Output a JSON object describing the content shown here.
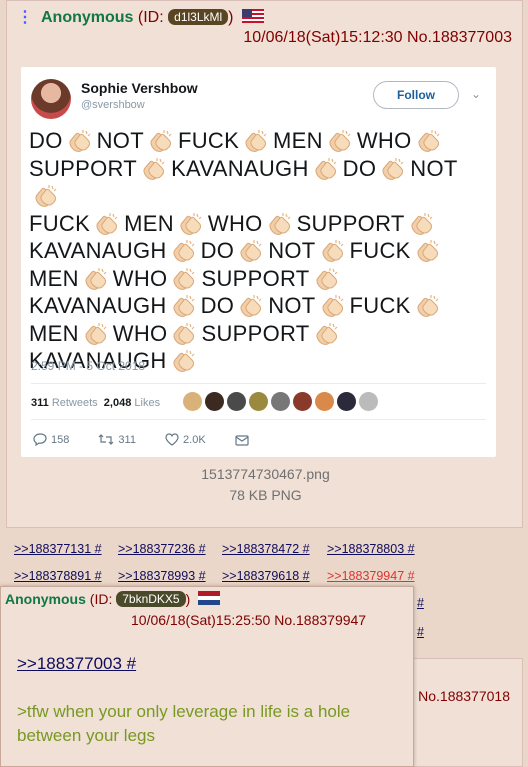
{
  "post1": {
    "menu": "⋮",
    "name": "Anonymous",
    "id_open": "(ID:",
    "id": "d1l3LkMl",
    "id_close": ")",
    "datetime": "10/06/18(Sat)15:12:30",
    "number": "No.188377003",
    "tweet": {
      "display_name": "Sophie Vershbow",
      "handle": "@svershbow",
      "follow": "Follow",
      "text_lines": [
        [
          "DO",
          "NOT",
          "FUCK",
          "MEN",
          "WHO"
        ],
        [
          "SUPPORT",
          "KAVANAUGH",
          "DO",
          "NOT"
        ],
        [
          "FUCK",
          "MEN",
          "WHO",
          "SUPPORT"
        ],
        [
          "KAVANAUGH",
          "DO",
          "NOT",
          "FUCK"
        ],
        [
          "MEN",
          "WHO",
          "SUPPORT"
        ],
        [
          "KAVANAUGH",
          "DO",
          "NOT",
          "FUCK"
        ],
        [
          "MEN",
          "WHO",
          "SUPPORT"
        ],
        [
          "KAVANAUGH"
        ]
      ],
      "date": "2:59 PM - 5 Oct 2018",
      "retweets": "311",
      "retweets_label": "Retweets",
      "likes": "2,048",
      "likes_label": "Likes",
      "replies_action": "158",
      "retweets_action": "311",
      "likes_action": "2.0K"
    },
    "file_name": "1513774730467.png",
    "file_info": "78 KB PNG"
  },
  "replies": [
    ">>188377131 #",
    ">>188377236 #",
    ">>188378472 #",
    ">>188378803 #",
    ">>188378891 #",
    ">>188378993 #",
    ">>188379618 #",
    ">>188379947 #",
    "#",
    "#"
  ],
  "post3": {
    "number": "No.188377018"
  },
  "hover_post": {
    "name": "Anonymous",
    "id_open": "(ID:",
    "id": "7bknDKX5",
    "id_close": ")",
    "datetime": "10/06/18(Sat)15:25:50",
    "number": "No.188379947",
    "quote": ">>188377003 #",
    "greentext": ">tfw when your only leverage in life is a hole between your legs"
  },
  "colors": {
    "page_bg": "#ead7c9",
    "post_bg": "#f0e0d6",
    "name_green": "#117743",
    "link_blue": "#0f0c5d",
    "greentext": "#789922"
  }
}
